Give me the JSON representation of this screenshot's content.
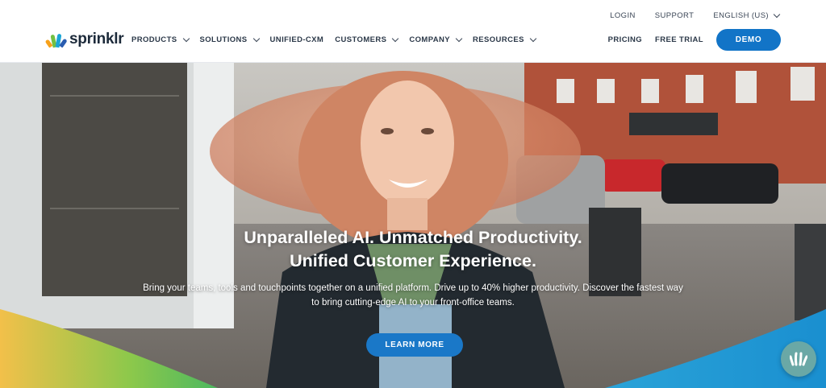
{
  "utility": {
    "login": "LOGIN",
    "support": "SUPPORT",
    "language": "ENGLISH (US)"
  },
  "logo": {
    "text": "sprinklr"
  },
  "nav": [
    {
      "label": "PRODUCTS",
      "has_dropdown": true
    },
    {
      "label": "SOLUTIONS",
      "has_dropdown": true
    },
    {
      "label": "UNIFIED-CXM",
      "has_dropdown": false
    },
    {
      "label": "CUSTOMERS",
      "has_dropdown": true
    },
    {
      "label": "COMPANY",
      "has_dropdown": true
    },
    {
      "label": "RESOURCES",
      "has_dropdown": true
    }
  ],
  "right_nav": {
    "pricing": "PRICING",
    "free_trial": "FREE TRIAL",
    "demo": "DEMO"
  },
  "hero": {
    "title_line1": "Unparalleled AI. Unmatched Productivity.",
    "title_line2": "Unified Customer Experience.",
    "subtitle_line1": "Bring your teams, tools and touchpoints together on a unified platform. Drive up to 40% higher productivity. Discover the fastest way",
    "subtitle_line2": "to bring cutting-edge AI to your front-office teams.",
    "cta": "LEARN MORE"
  },
  "colors": {
    "brand_blue": "#1274c7",
    "text_dark": "#2b3848",
    "chat_bg": "#6aa8a6"
  },
  "icons": {
    "chevron": "chevron-down-icon",
    "chat": "sprinklr-chat-icon"
  }
}
